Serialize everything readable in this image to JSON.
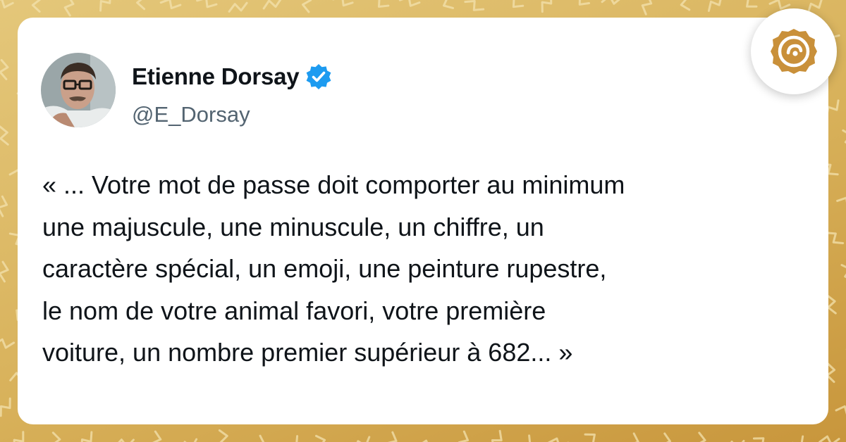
{
  "colors": {
    "background_gold": "#d8b15a",
    "card": "#ffffff",
    "text": "#0f1419",
    "handle": "#536471",
    "verified_blue": "#1d9bf0",
    "badge_gold": "#c9903a"
  },
  "tweet": {
    "author_name": "Etienne Dorsay",
    "handle": "@E_Dorsay",
    "verified_icon": "verified-badge-icon",
    "avatar_icon": "avatar-photo",
    "text": "« ... Votre mot de passe doit comporter au minimum\nune majuscule, une minuscule, un chiffre, un\ncaractère spécial, un emoji, une peinture rupestre,\nle nom de votre animal favori, votre première\nvoiture, un nombre premier supérieur à 682... »"
  },
  "badge": {
    "icon": "brand-logo-icon"
  }
}
